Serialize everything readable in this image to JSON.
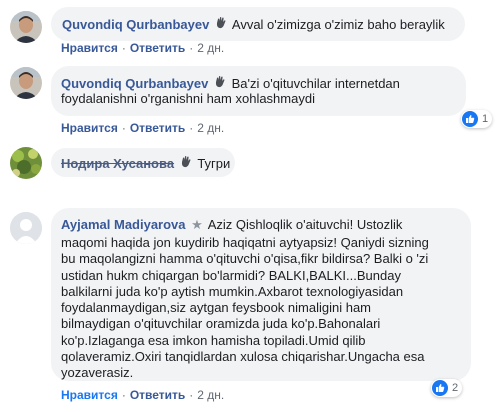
{
  "comments": [
    {
      "author": "Quvondiq Qurbanbayev",
      "badge_icon": "waving-hand-icon",
      "text": "Avval o'zimizga o'zimiz baho beraylik",
      "like_label": "Нравится",
      "reply_label": "Ответить",
      "time": "2 дн."
    },
    {
      "author": "Quvondiq Qurbanbayev",
      "badge_icon": "waving-hand-icon",
      "text_lines": [
        "Ba'zi o'qituvchilar internetdan",
        "foydalanishni o'rganishni ham xohlashmaydi"
      ],
      "like_label": "Нравится",
      "reply_label": "Ответить",
      "time": "2 дн.",
      "reaction_count": "1"
    },
    {
      "author": "Нодира Хусанова",
      "badge_icon": "waving-hand-icon",
      "text": "Тугри"
    },
    {
      "author": "Ayjamal Madiyarova",
      "badge_icon": "star-icon",
      "text_lines": [
        "Aziz Qishloqlik o'aituvchi! Ustozlik",
        "maqomi haqida jon kuydirib haqiqatni aytyapsiz! Qaniydi sizning",
        "bu maqolangizni hamma o'qituvchi o'qisa,fikr bildirsa? Balki o 'zi",
        "ustidan hukm chiqargan bo'larmidi? BALKI,BALKI...Bunday",
        "balkilarni juda ko'p aytish mumkin.Axbarot texnologiyasidan",
        "foydalanmaydigan,siz aytgan feysbook nimaligini ham",
        "bilmaydigan o'qituvchilar oramizda juda ko'p.Bahonalari",
        "ko'p.Izlaganga esa imkon hamisha topiladi.Umid qilib",
        "qolaveramiz.Oxiri tanqidlardan xulosa chiqarishar.Ungacha esa",
        "yozaverasiz."
      ],
      "like_label": "Нравится",
      "reply_label": "Ответить",
      "time": "2 дн.",
      "reaction_count": "2"
    }
  ]
}
